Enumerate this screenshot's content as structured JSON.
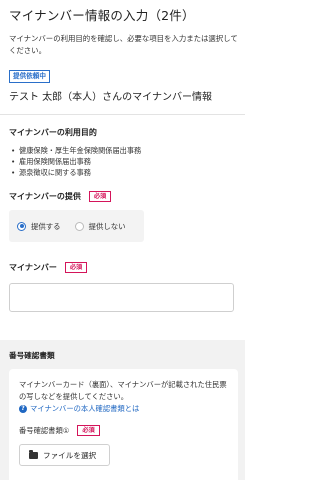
{
  "header": {
    "title": "マイナンバー情報の入力（2件）",
    "intro": "マイナンバーの利用目的を確認し、必要な項目を入力または選択してください。"
  },
  "person": {
    "badge": "提供依頼中",
    "title": "テスト 太郎（本人）さんのマイナンバー情報"
  },
  "purpose": {
    "label": "マイナンバーの利用目的",
    "items": [
      "健康保険・厚生年金保険関係届出事務",
      "雇用保険関係届出事務",
      "源泉徴収に関する事務"
    ]
  },
  "provide": {
    "label": "マイナンバーの提供",
    "required": "必須",
    "options": [
      "提供する",
      "提供しない"
    ],
    "selected": "提供する"
  },
  "mynumber": {
    "label": "マイナンバー",
    "required": "必須",
    "value": ""
  },
  "document": {
    "heading": "番号確認書類",
    "description": "マイナンバーカード（裏面）、マイナンバーが記載された住民票の写しなどを提供してください。",
    "help_link": "マイナンバーの本人確認書類とは",
    "type_label": "番号確認書類①",
    "required": "必須",
    "file_button": "ファイルを選択"
  }
}
